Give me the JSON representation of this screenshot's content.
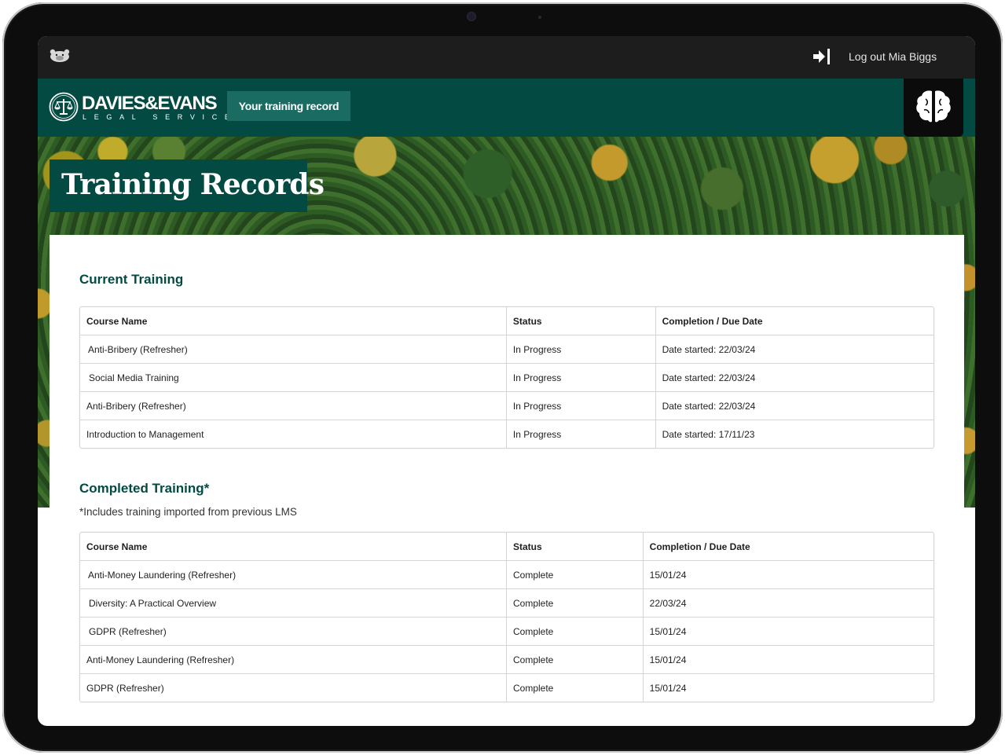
{
  "topbar": {
    "app_icon": "mole-logo-icon",
    "logout_icon": "logout-arrow-icon",
    "logout_label": "Log out Mia Biggs"
  },
  "brand": {
    "name": "DAVIES&EVANS",
    "subtitle": "LEGAL SERVICES",
    "emblem_icon": "scales-emblem-icon",
    "nav_button": "Your training record",
    "assistant_icon": "brain-icon"
  },
  "colors": {
    "brand_green": "#034a42",
    "button_green": "#1a6b62",
    "topbar": "#1d1d1d"
  },
  "hero": {
    "title": "Training Records"
  },
  "current_training": {
    "heading": "Current Training",
    "columns": [
      "Course Name",
      "Status",
      "Completion / Due Date"
    ],
    "rows": [
      [
        "Anti-Bribery (Refresher)",
        "In Progress",
        "Date started: 22/03/24"
      ],
      [
        "Social Media Training",
        "In Progress",
        "Date started: 22/03/24"
      ],
      [
        "Anti-Bribery (Refresher)",
        "In Progress",
        "Date started: 22/03/24"
      ],
      [
        "Introduction to Management",
        "In Progress",
        "Date started: 17/11/23"
      ]
    ]
  },
  "completed_training": {
    "heading": "Completed Training*",
    "note": "*Includes training imported from previous LMS",
    "columns": [
      "Course Name",
      "Status",
      "Completion / Due Date"
    ],
    "rows": [
      [
        "Anti-Money Laundering (Refresher)",
        "Complete",
        "15/01/24"
      ],
      [
        "Diversity: A Practical Overview",
        "Complete",
        "22/03/24"
      ],
      [
        "GDPR (Refresher)",
        "Complete",
        "15/01/24"
      ],
      [
        "Anti-Money Laundering (Refresher)",
        "Complete",
        "15/01/24"
      ],
      [
        "GDPR (Refresher)",
        "Complete",
        "15/01/24"
      ]
    ]
  }
}
